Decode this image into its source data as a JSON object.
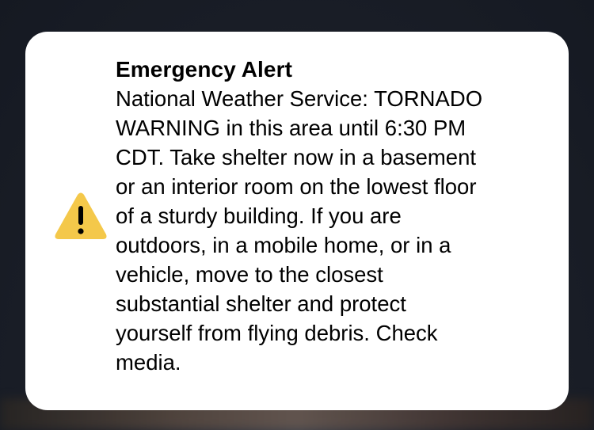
{
  "alert": {
    "title": "Emergency Alert",
    "body": "National Weather Service: TORNADO\nWARNING in this area until 6:30 PM\nCDT. Take shelter now in a basement\nor an interior room on the lowest floor\nof a sturdy building. If you are\noutdoors, in a mobile home, or in a\nvehicle, move to the closest\nsubstantial shelter and protect\nyourself from flying debris. Check\nmedia.",
    "icon": "warning-triangle-icon",
    "icon_color": "#F4C84A",
    "icon_glyph_color": "#000000",
    "card_color": "#FFFFFF"
  }
}
